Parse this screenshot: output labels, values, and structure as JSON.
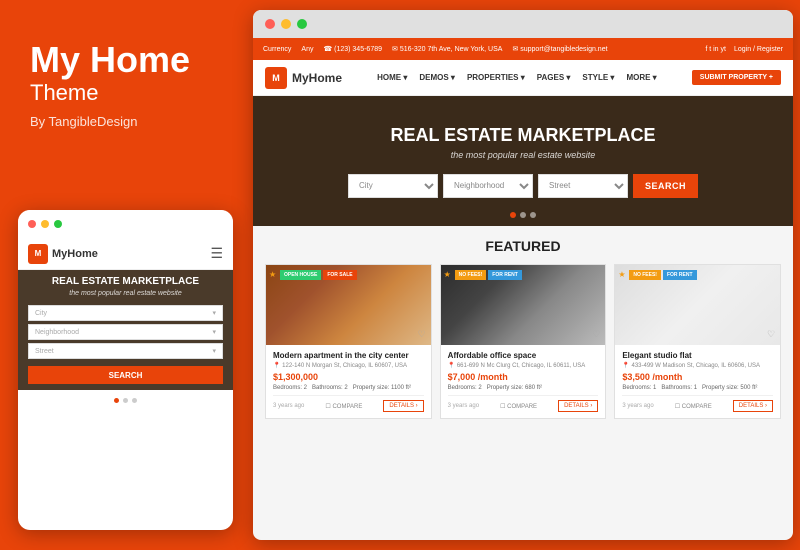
{
  "left": {
    "title": "My Home",
    "subtitle": "Theme",
    "by": "By TangibleDesign"
  },
  "mobile": {
    "logo": "MyHome",
    "hero_title": "REAL ESTATE MARKETPLACE",
    "hero_sub": "the most popular real estate website",
    "city": "City",
    "neighborhood": "Neighborhood",
    "street": "Street",
    "search_btn": "SEARCH",
    "dots": [
      true,
      false,
      false
    ]
  },
  "browser": {
    "infobar": {
      "phone1": "☎ (123) 345-6789",
      "address": "✉ 516-320 7th Ave, New York, USA",
      "email": "✉ support@tangibledesign.net",
      "currency": "Currency",
      "any": "Any",
      "login": "Login / Register"
    },
    "nav": {
      "logo": "MyHome",
      "links": [
        "HOME ▾",
        "DEMOS ▾",
        "PROPERTIES ▾",
        "PAGES ▾",
        "STYLE ▾",
        "MORE ▾"
      ],
      "submit": "SUBMIT PROPERTY +"
    },
    "hero": {
      "title": "REAL ESTATE MARKETPLACE",
      "subtitle": "the most popular real estate website",
      "city_placeholder": "City",
      "neighborhood_placeholder": "Neighborhood",
      "street_placeholder": "Street",
      "search_btn": "SEARCH"
    },
    "featured": {
      "title": "FEATURED",
      "cards": [
        {
          "badges": [
            "OPEN HOUSE",
            "FOR SALE"
          ],
          "badge_colors": [
            "green",
            "orange"
          ],
          "title": "Modern apartment in the city center",
          "address": "122-140 N Morgan St, Chicago, IL 60607, USA",
          "price": "$1,300,000",
          "details": "Bedrooms: 2  Bathrooms: 2  Property size: 1100 ft²",
          "time_ago": "3 years ago",
          "compare": "COMPARE",
          "details_btn": "DETAILS ›"
        },
        {
          "badges": [
            "NO FEES!",
            "FOR RENT"
          ],
          "badge_colors": [
            "yellow",
            "blue"
          ],
          "title": "Affordable office space",
          "address": "661-699 N Mc Clurg Ct, Chicago, IL 60611, USA",
          "price": "$7,000 /month",
          "details": "Bedrooms: 2  Property size: 680 ft²",
          "time_ago": "3 years ago",
          "compare": "COMPARE",
          "details_btn": "DETAILS ›"
        },
        {
          "badges": [
            "NO FEES!",
            "FOR RENT"
          ],
          "badge_colors": [
            "yellow",
            "blue"
          ],
          "title": "Elegant studio flat",
          "address": "433-499 W Madison St, Chicago, IL 60606, USA",
          "price": "$3,500 /month",
          "details": "Bedrooms: 1  Bathrooms: 1  Property size: 500 ft²",
          "time_ago": "3 years ago",
          "compare": "COMPARE",
          "details_btn": "DETAILS ›"
        }
      ]
    }
  }
}
